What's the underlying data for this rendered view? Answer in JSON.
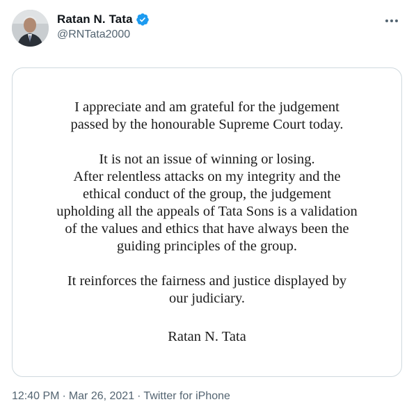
{
  "author": {
    "display_name": "Ratan N. Tata",
    "handle": "@RNTata2000",
    "verified": true,
    "verified_color": "#1d9bf0"
  },
  "statement": {
    "paragraph_1": [
      "I appreciate and am grateful for the judgement",
      "passed by the honourable Supreme Court today."
    ],
    "paragraph_2": [
      "It is not an issue of winning or losing.",
      "After relentless attacks on my integrity and the",
      "ethical conduct of the group, the judgement",
      "upholding all the appeals of Tata Sons is a validation",
      "of the values and ethics that have always been the",
      "guiding principles of the group."
    ],
    "paragraph_3": [
      "It reinforces the fairness and justice displayed by",
      "our judiciary."
    ],
    "signature": "Ratan N. Tata"
  },
  "meta": {
    "time": "12:40 PM",
    "separator": "·",
    "date": "Mar 26, 2021",
    "source": "Twitter for iPhone"
  },
  "icons": {
    "verified": "verified-badge-icon",
    "more": "more-options-icon"
  },
  "colors": {
    "secondary_text": "#536471",
    "border": "#cfd9de",
    "primary_text": "#0f1419"
  }
}
